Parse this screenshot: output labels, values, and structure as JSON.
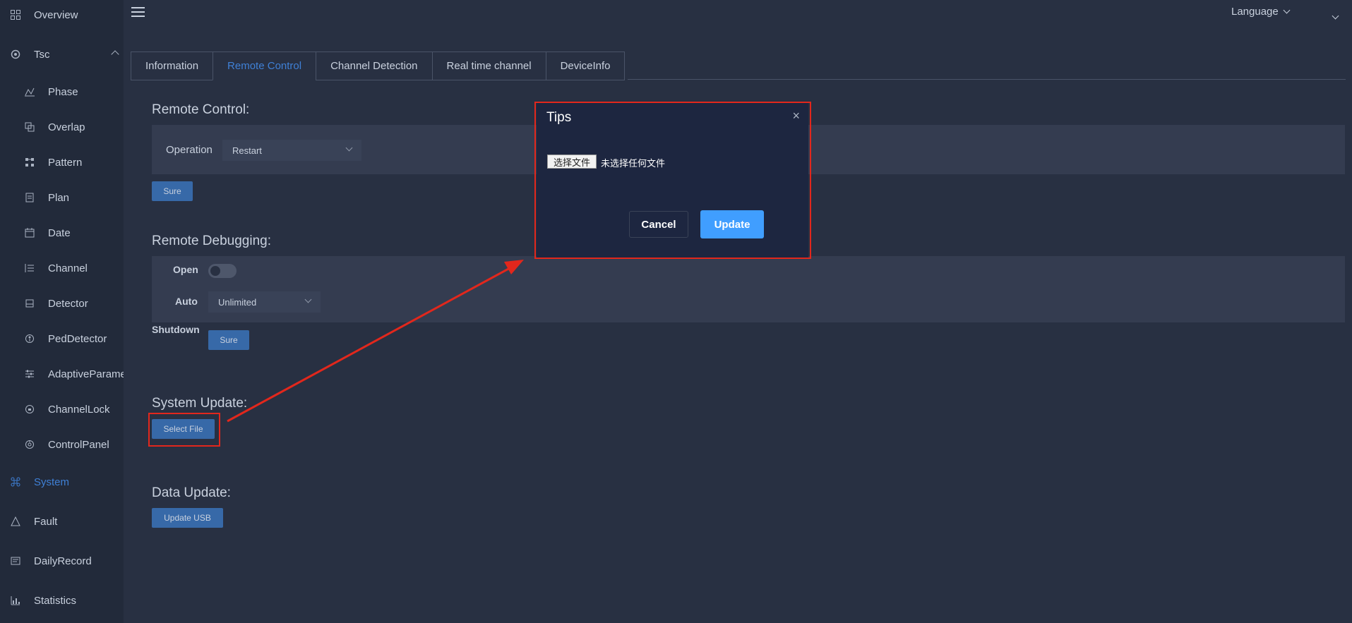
{
  "sidebar": {
    "overview": "Overview",
    "tsc": "Tsc",
    "items": [
      "Phase",
      "Overlap",
      "Pattern",
      "Plan",
      "Date",
      "Channel",
      "Detector",
      "PedDetector",
      "AdaptiveParameter",
      "ChannelLock",
      "ControlPanel"
    ],
    "system": "System",
    "fault": "Fault",
    "daily_record": "DailyRecord",
    "statistics": "Statistics"
  },
  "header": {
    "language": "Language"
  },
  "tabs": [
    "Information",
    "Remote Control",
    "Channel Detection",
    "Real time channel",
    "DeviceInfo"
  ],
  "active_tab": "Remote Control",
  "remote_control": {
    "title": "Remote Control:",
    "operation_label": "Operation",
    "operation_value": "Restart",
    "sure": "Sure"
  },
  "remote_debugging": {
    "title": "Remote Debugging:",
    "open_label": "Open",
    "auto_label": "Auto",
    "auto_value": "Unlimited",
    "shutdown_label": "Shutdown",
    "sure": "Sure"
  },
  "system_update": {
    "title": "System Update:",
    "select_file": "Select File"
  },
  "data_update": {
    "title": "Data Update:",
    "update_usb": "Update USB"
  },
  "dialog": {
    "title": "Tips",
    "choose_file": "选择文件",
    "no_file": "未选择任何文件",
    "cancel": "Cancel",
    "update": "Update"
  },
  "colors": {
    "accent": "#3f80d6",
    "primary_button": "#409eff",
    "highlight": "#e2271c"
  }
}
